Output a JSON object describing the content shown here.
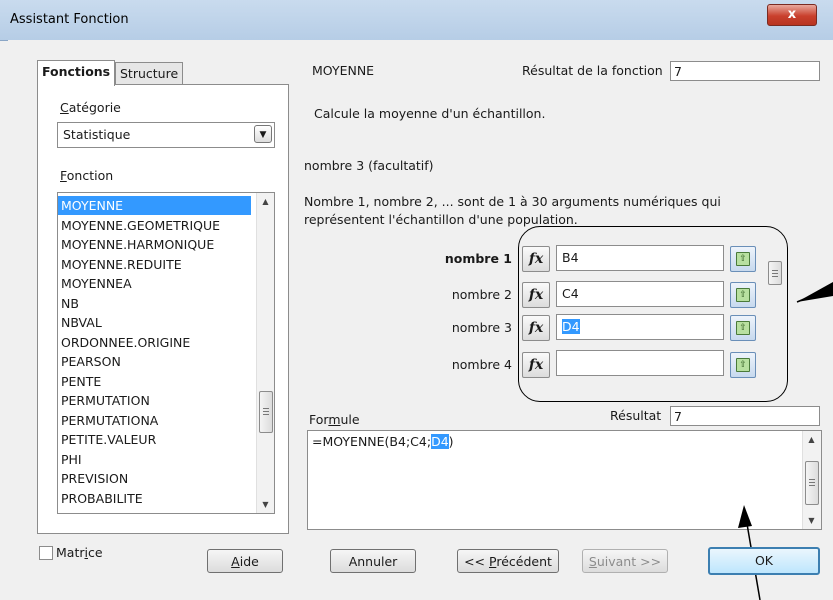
{
  "window": {
    "title": "Assistant Fonction",
    "close_glyph": "x"
  },
  "tabs": [
    {
      "label": "Fonctions"
    },
    {
      "label": "Structure"
    }
  ],
  "left": {
    "categorie_label": "Catégorie",
    "categorie_value": "Statistique",
    "fonction_label": "Fonction",
    "functions": [
      "MOYENNE",
      "MOYENNE.GEOMETRIQUE",
      "MOYENNE.HARMONIQUE",
      "MOYENNE.REDUITE",
      "MOYENNEA",
      "NB",
      "NBVAL",
      "ORDONNEE.ORIGINE",
      "PEARSON",
      "PENTE",
      "PERMUTATION",
      "PERMUTATIONA",
      "PETITE.VALEUR",
      "PHI",
      "PREVISION",
      "PROBABILITE"
    ],
    "selected_function": "MOYENNE"
  },
  "right": {
    "function_name": "MOYENNE",
    "resultat_fonction_label": "Résultat de la fonction",
    "resultat_fonction_value": "7",
    "description": "Calcule la moyenne d'un échantillon.",
    "arg_title": "nombre 3 (facultatif)",
    "arg_desc_line1": "Nombre 1, nombre 2, ... sont de 1 à 30 arguments numériques qui",
    "arg_desc_line2": "représentent l'échantillon d'une population.",
    "fx_glyph": "fx",
    "args": [
      {
        "label": "nombre 1",
        "value": "B4"
      },
      {
        "label": "nombre 2",
        "value": "C4"
      },
      {
        "label": "nombre 3",
        "value": "D4"
      },
      {
        "label": "nombre 4",
        "value": ""
      }
    ],
    "formule_label": "Formule",
    "resultat_label": "Résultat",
    "resultat_value": "7",
    "formula_prefix": "=MOYENNE(B4;C4;",
    "formula_selected": "D4",
    "formula_suffix": ")"
  },
  "bottom": {
    "matrice_label": "Matrice",
    "aide_label": "Aide",
    "annuler_label": "Annuler",
    "precedent_label": "<< Précédent",
    "suivant_label": "Suivant >>",
    "ok_label": "OK"
  }
}
